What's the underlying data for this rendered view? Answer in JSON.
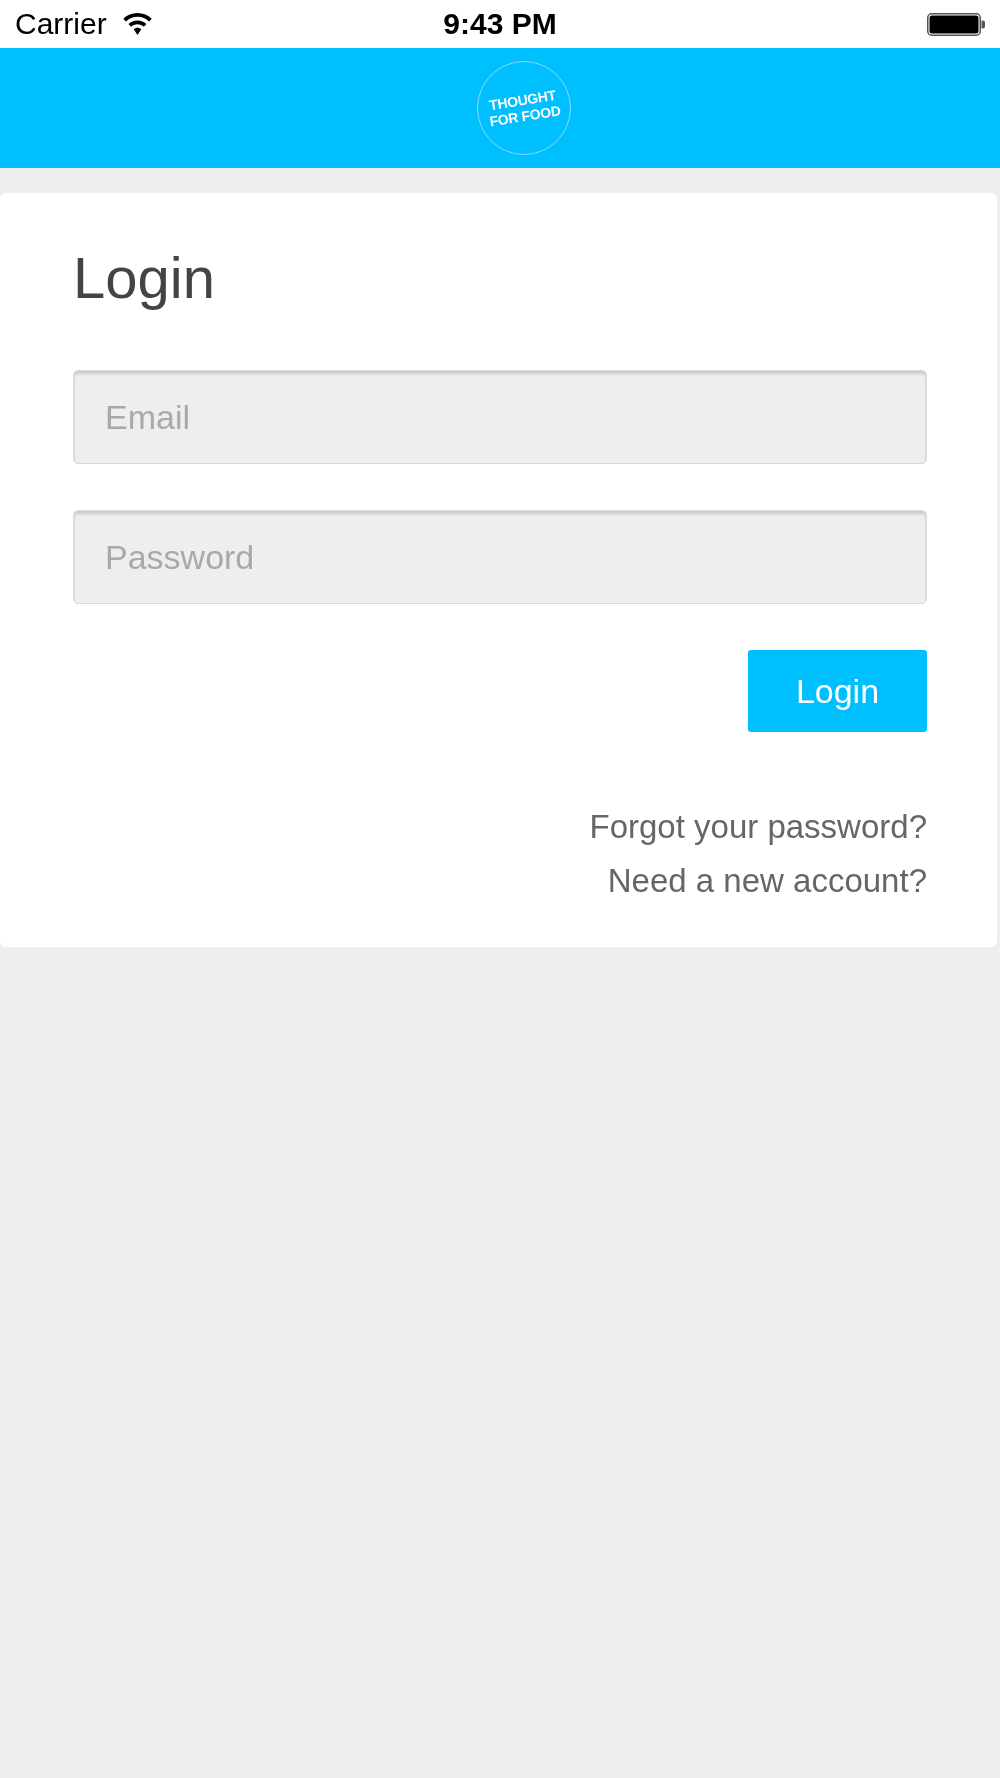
{
  "status_bar": {
    "carrier": "Carrier",
    "time": "9:43 PM"
  },
  "header": {
    "logo_lines": [
      "THOUGHT",
      "FOR FOOD"
    ]
  },
  "login_card": {
    "title": "Login",
    "fields": [
      {
        "placeholder": "Email"
      },
      {
        "placeholder": "Password"
      }
    ],
    "submit_button": "Login",
    "links": [
      "Forgot your password?",
      "Need a new account?"
    ]
  }
}
